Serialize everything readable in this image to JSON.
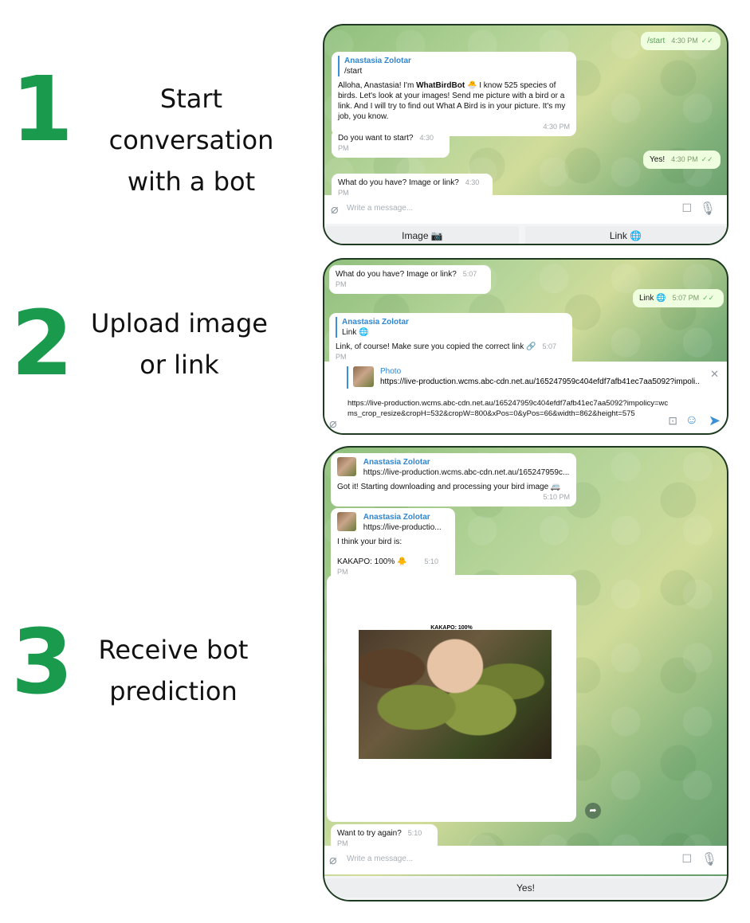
{
  "steps": [
    {
      "number": "1",
      "text": "Start conversation\nwith a bot"
    },
    {
      "number": "2",
      "text": "Upload image\nor link"
    },
    {
      "number": "3",
      "text": "Receive bot\nprediction"
    }
  ],
  "panel1": {
    "messages": {
      "start_out": {
        "text": "/start",
        "time": "4:30 PM"
      },
      "greeting": {
        "reply_author": "Anastasia Zolotar",
        "reply_text": "/start",
        "text_pre": "Alloha, Anastasia! I'm ",
        "text_bold": "WhatBirdBot",
        "text_post": " 🐣 I know 525 species of birds. Let's look at your images! Send me picture with a bird or a link. And I will try to find out What A Bird is in your picture. It's my job, you know.",
        "time": "4:30 PM"
      },
      "want_start": {
        "text": "Do you want to start?",
        "time": "4:30 PM"
      },
      "yes_out": {
        "text": "Yes!",
        "time": "4:30 PM"
      },
      "what_have": {
        "text": "What do you have? Image or link?",
        "time": "4:30 PM"
      }
    },
    "input_placeholder": "Write a message...",
    "keyboard": {
      "image_label": "Image 📷",
      "link_label": "Link 🌐"
    }
  },
  "panel2": {
    "messages": {
      "what_have": {
        "text": "What do you have? Image or link?",
        "time": "5:07 PM"
      },
      "link_out": {
        "text": "Link 🌐",
        "time": "5:07 PM"
      },
      "link_reply": {
        "reply_author": "Anastasia Zolotar",
        "reply_text": "Link 🌐",
        "text": "Link, of course! Make sure you copied the correct link 🔗",
        "time": "5:07 PM"
      }
    },
    "preview": {
      "title": "Photo",
      "url": "https://live-production.wcms.abc-cdn.net.au/165247959c404efdf7afb41ec7aa5092?impoli..."
    },
    "input_text": "https://live-production.wcms.abc-cdn.net.au/165247959c404efdf7afb41ec7aa5092?impolicy=wcms_crop_resize&cropH=532&cropW=800&xPos=0&yPos=66&width=862&height=575"
  },
  "panel3": {
    "messages": {
      "got_it": {
        "reply_author": "Anastasia Zolotar",
        "reply_text": "https://live-production.wcms.abc-cdn.net.au/165247959c...",
        "text": "Got it! Starting downloading and processing your bird image 🚐",
        "time": "5:10 PM"
      },
      "prediction": {
        "reply_author": "Anastasia Zolotar",
        "reply_text": "https://live-productio...",
        "line1": "I think your bird is:",
        "line2": "KAKAPO: 100% 🐥",
        "time": "5:10 PM"
      },
      "image_caption": "KAKAPO: 100%",
      "try_again": {
        "text": "Want to try again?",
        "time": "5:10 PM"
      }
    },
    "input_placeholder": "Write a message...",
    "keyboard": {
      "yes_label": "Yes!"
    }
  },
  "icons": {
    "attach": "paperclip-icon",
    "emoji_keyboard": "sticker-icon",
    "mic": "microphone-icon",
    "send": "send-icon",
    "close": "close-icon",
    "forward": "forward-icon",
    "bot_commands": "commands-icon",
    "emoji": "emoji-icon"
  },
  "colors": {
    "accent_green": "#1a9a4d",
    "link_blue": "#2f86cf",
    "outgoing_bubble": "#eefedf"
  }
}
